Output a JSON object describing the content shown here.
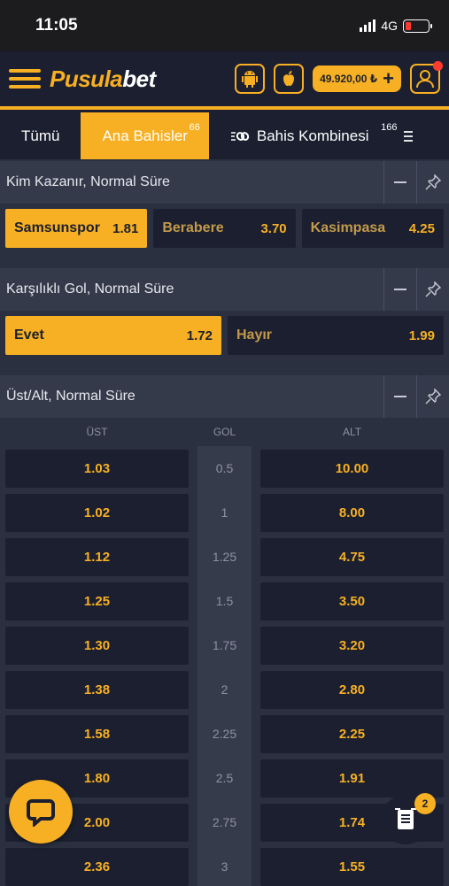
{
  "status_bar": {
    "time": "11:05",
    "network": "4G"
  },
  "header": {
    "logo_main": "Pusula",
    "logo_accent": "bet",
    "balance": "49.920,00 ₺",
    "balance_plus": "+"
  },
  "tabs": [
    {
      "label": "Tümü"
    },
    {
      "label": "Ana Bahisler",
      "count": "66"
    },
    {
      "label": "Bahis Kombinesi",
      "count": "166"
    }
  ],
  "markets": {
    "winner": {
      "title": "Kim Kazanır, Normal Süre",
      "options": [
        {
          "name": "Samsunspor",
          "odd": "1.81",
          "selected": true
        },
        {
          "name": "Berabere",
          "odd": "3.70",
          "selected": false
        },
        {
          "name": "Kasimpasa",
          "odd": "4.25",
          "selected": false
        }
      ]
    },
    "btts": {
      "title": "Karşılıklı Gol, Normal Süre",
      "options": [
        {
          "name": "Evet",
          "odd": "1.72",
          "selected": true
        },
        {
          "name": "Hayır",
          "odd": "1.99",
          "selected": false
        }
      ]
    },
    "over_under": {
      "title": "Üst/Alt, Normal Süre",
      "col_over": "ÜST",
      "col_goal": "GOL",
      "col_under": "ALT",
      "rows": [
        {
          "over": "1.03",
          "goal": "0.5",
          "under": "10.00"
        },
        {
          "over": "1.02",
          "goal": "1",
          "under": "8.00"
        },
        {
          "over": "1.12",
          "goal": "1.25",
          "under": "4.75"
        },
        {
          "over": "1.25",
          "goal": "1.5",
          "under": "3.50"
        },
        {
          "over": "1.30",
          "goal": "1.75",
          "under": "3.20"
        },
        {
          "over": "1.38",
          "goal": "2",
          "under": "2.80"
        },
        {
          "over": "1.58",
          "goal": "2.25",
          "under": "2.25"
        },
        {
          "over": "1.80",
          "goal": "2.5",
          "under": "1.91"
        },
        {
          "over": "2.00",
          "goal": "2.75",
          "under": "1.74"
        },
        {
          "over": "2.36",
          "goal": "3",
          "under": "1.55"
        }
      ]
    }
  },
  "bet_slip": {
    "count": "2"
  },
  "colors": {
    "accent": "#f7b023",
    "dark": "#1b1f2f",
    "bg": "#2b3040"
  }
}
